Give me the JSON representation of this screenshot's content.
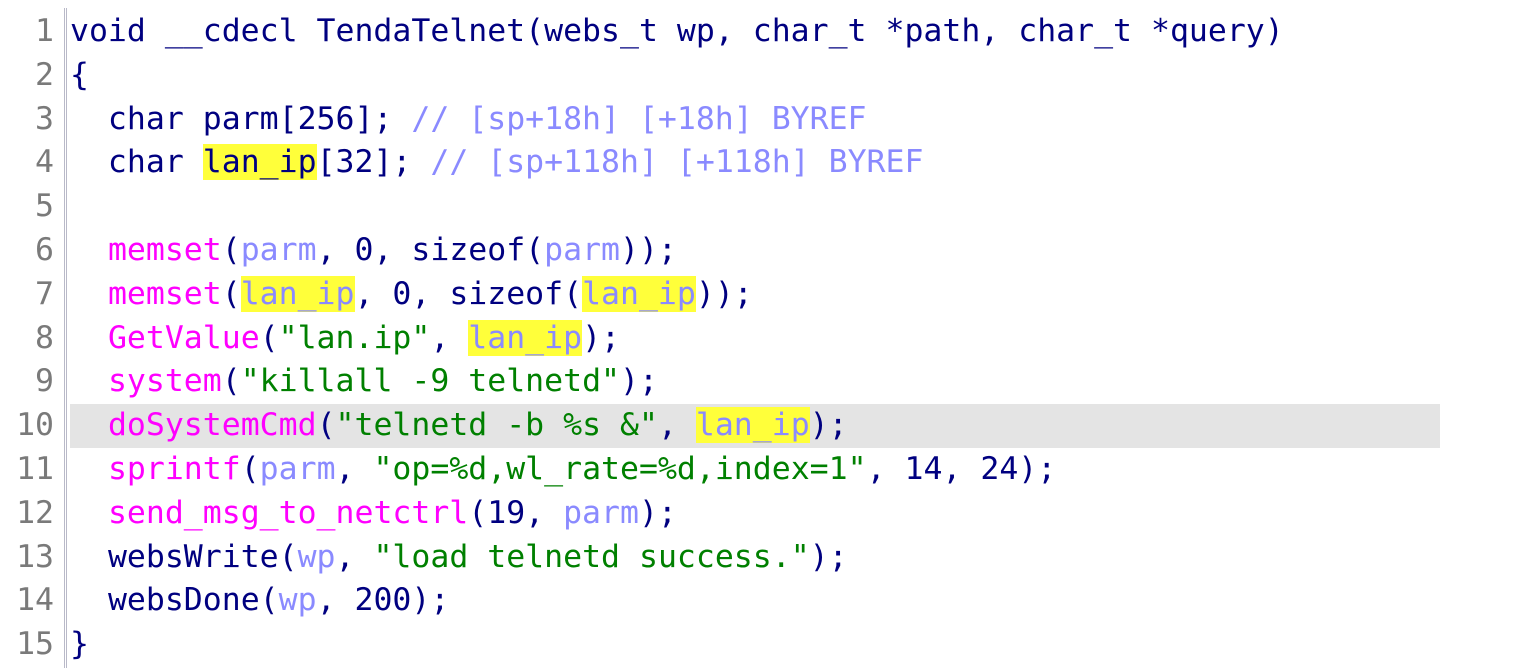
{
  "editor": {
    "colors": {
      "background": "#ffffff",
      "line_number": "#7a7a7a",
      "keyword": "#000080",
      "function": "#ff00ff",
      "variable": "#8a8aff",
      "string": "#008000",
      "comment": "#8a8aff",
      "highlight": "#ffff3a",
      "current_line": "#e4e4e4"
    },
    "current_line": 10,
    "lines": [
      {
        "num": "1",
        "tokens": [
          {
            "t": "void __cdecl TendaTelnet(webs_t wp, char_t *path, char_t *query)",
            "c": "plain"
          }
        ]
      },
      {
        "num": "2",
        "tokens": [
          {
            "t": "{",
            "c": "plain"
          }
        ]
      },
      {
        "num": "3",
        "tokens": [
          {
            "t": "  char parm[256]; ",
            "c": "plain"
          },
          {
            "t": "// [sp+18h] [+18h] BYREF",
            "c": "cmt"
          }
        ]
      },
      {
        "num": "4",
        "tokens": [
          {
            "t": "  char ",
            "c": "plain"
          },
          {
            "t": "lan_ip",
            "c": "hl-dark"
          },
          {
            "t": "[32]; ",
            "c": "plain"
          },
          {
            "t": "// [sp+118h] [+118h] BYREF",
            "c": "cmt"
          }
        ]
      },
      {
        "num": "5",
        "tokens": []
      },
      {
        "num": "6",
        "tokens": [
          {
            "t": "  ",
            "c": "plain"
          },
          {
            "t": "memset",
            "c": "fn"
          },
          {
            "t": "(",
            "c": "plain"
          },
          {
            "t": "parm",
            "c": "var"
          },
          {
            "t": ", 0, sizeof(",
            "c": "plain"
          },
          {
            "t": "parm",
            "c": "var"
          },
          {
            "t": "));",
            "c": "plain"
          }
        ]
      },
      {
        "num": "7",
        "tokens": [
          {
            "t": "  ",
            "c": "plain"
          },
          {
            "t": "memset",
            "c": "fn"
          },
          {
            "t": "(",
            "c": "plain"
          },
          {
            "t": "lan_ip",
            "c": "hl"
          },
          {
            "t": ", 0, sizeof(",
            "c": "plain"
          },
          {
            "t": "lan_ip",
            "c": "hl"
          },
          {
            "t": "));",
            "c": "plain"
          }
        ]
      },
      {
        "num": "8",
        "tokens": [
          {
            "t": "  ",
            "c": "plain"
          },
          {
            "t": "GetValue",
            "c": "fn"
          },
          {
            "t": "(",
            "c": "plain"
          },
          {
            "t": "\"lan.ip\"",
            "c": "str"
          },
          {
            "t": ", ",
            "c": "plain"
          },
          {
            "t": "lan_ip",
            "c": "hl"
          },
          {
            "t": ");",
            "c": "plain"
          }
        ]
      },
      {
        "num": "9",
        "tokens": [
          {
            "t": "  ",
            "c": "plain"
          },
          {
            "t": "system",
            "c": "fn"
          },
          {
            "t": "(",
            "c": "plain"
          },
          {
            "t": "\"killall -9 telnetd\"",
            "c": "str"
          },
          {
            "t": ");",
            "c": "plain"
          }
        ]
      },
      {
        "num": "10",
        "tokens": [
          {
            "t": "  ",
            "c": "plain"
          },
          {
            "t": "doSystemCmd",
            "c": "fn"
          },
          {
            "t": "(",
            "c": "plain"
          },
          {
            "t": "\"telnetd -b %s &\"",
            "c": "str"
          },
          {
            "t": ", ",
            "c": "plain"
          },
          {
            "t": "lan_ip",
            "c": "hl"
          },
          {
            "t": ");",
            "c": "plain"
          }
        ]
      },
      {
        "num": "11",
        "tokens": [
          {
            "t": "  ",
            "c": "plain"
          },
          {
            "t": "sprintf",
            "c": "fn"
          },
          {
            "t": "(",
            "c": "plain"
          },
          {
            "t": "parm",
            "c": "var"
          },
          {
            "t": ", ",
            "c": "plain"
          },
          {
            "t": "\"op=%d,wl_rate=%d,index=1\"",
            "c": "str"
          },
          {
            "t": ", 14, 24);",
            "c": "plain"
          }
        ]
      },
      {
        "num": "12",
        "tokens": [
          {
            "t": "  ",
            "c": "plain"
          },
          {
            "t": "send_msg_to_netctrl",
            "c": "fn"
          },
          {
            "t": "(19, ",
            "c": "plain"
          },
          {
            "t": "parm",
            "c": "var"
          },
          {
            "t": ");",
            "c": "plain"
          }
        ]
      },
      {
        "num": "13",
        "tokens": [
          {
            "t": "  ",
            "c": "plain"
          },
          {
            "t": "websWrite",
            "c": "plain"
          },
          {
            "t": "(",
            "c": "plain"
          },
          {
            "t": "wp",
            "c": "var"
          },
          {
            "t": ", ",
            "c": "plain"
          },
          {
            "t": "\"load telnetd success.\"",
            "c": "str"
          },
          {
            "t": ");",
            "c": "plain"
          }
        ]
      },
      {
        "num": "14",
        "tokens": [
          {
            "t": "  ",
            "c": "plain"
          },
          {
            "t": "websDone",
            "c": "plain"
          },
          {
            "t": "(",
            "c": "plain"
          },
          {
            "t": "wp",
            "c": "var"
          },
          {
            "t": ", 200);",
            "c": "plain"
          }
        ]
      },
      {
        "num": "15",
        "tokens": [
          {
            "t": "}",
            "c": "plain"
          }
        ]
      }
    ]
  }
}
